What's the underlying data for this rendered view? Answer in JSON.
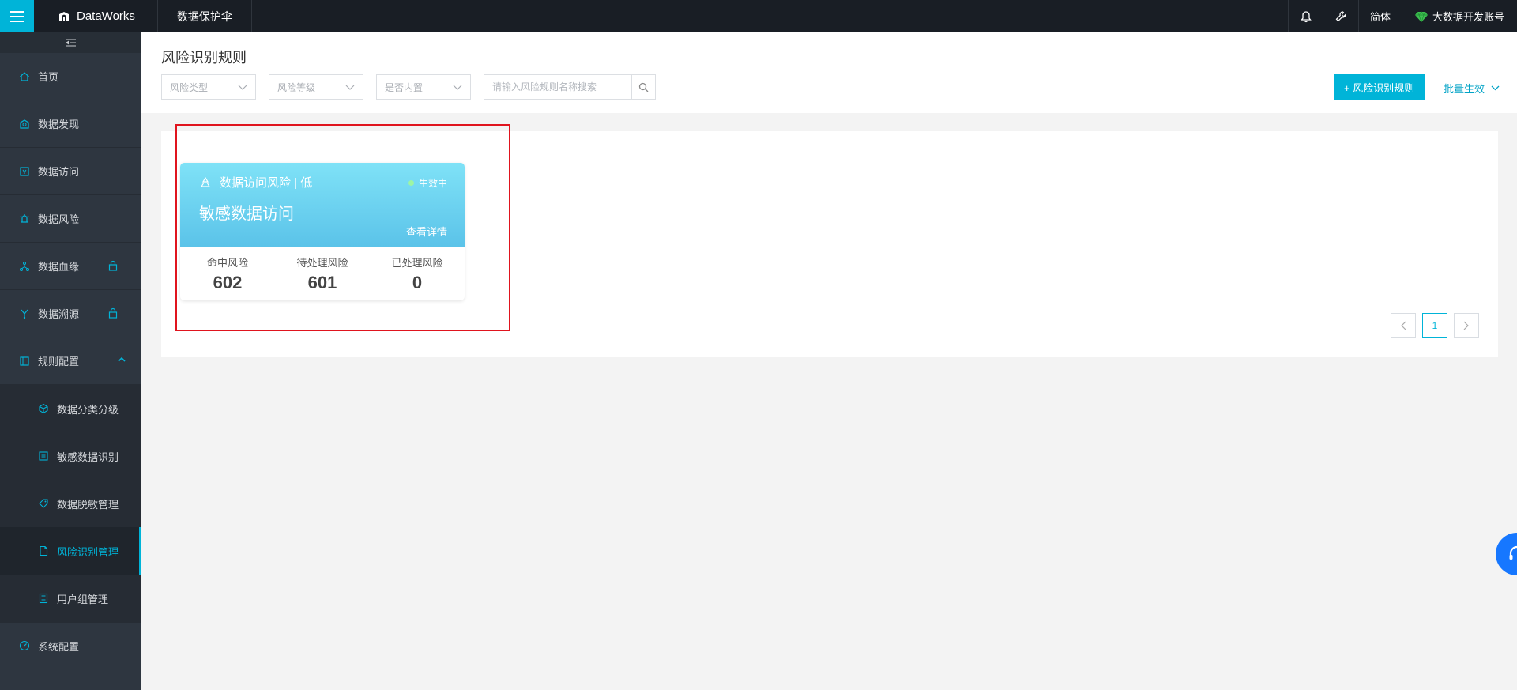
{
  "topbar": {
    "brand": "DataWorks",
    "product": "数据保护伞",
    "language": "简体",
    "account": "大数据开发账号"
  },
  "sidebar": {
    "items": [
      {
        "label": "首页",
        "icon": "home-icon"
      },
      {
        "label": "数据发现",
        "icon": "discovery-icon"
      },
      {
        "label": "数据访问",
        "icon": "access-icon"
      },
      {
        "label": "数据风险",
        "icon": "alarm-icon"
      },
      {
        "label": "数据血缘",
        "icon": "lineage-icon",
        "locked": true
      },
      {
        "label": "数据溯源",
        "icon": "trace-icon",
        "locked": true
      },
      {
        "label": "规则配置",
        "icon": "rules-icon",
        "expanded": true
      }
    ],
    "sub_items": [
      {
        "label": "数据分类分级",
        "icon": "cube-icon"
      },
      {
        "label": "敏感数据识别",
        "icon": "list-icon"
      },
      {
        "label": "数据脱敏管理",
        "icon": "tag-icon"
      },
      {
        "label": "风险识别管理",
        "icon": "doc-icon",
        "active": true
      },
      {
        "label": "用户组管理",
        "icon": "book-icon"
      }
    ],
    "bottom_item": {
      "label": "系统配置",
      "icon": "gauge-icon"
    }
  },
  "header": {
    "title": "风险识别规则",
    "filters": {
      "risk_type": "风险类型",
      "risk_level": "风险等级",
      "builtin": "是否内置"
    },
    "search_placeholder": "请输入风险规则名称搜索",
    "add_button": "+ 风险识别规则",
    "batch": "批量生效"
  },
  "card": {
    "type": "数据访问风险 | 低",
    "status": "生效中",
    "name": "敏感数据访问",
    "detail_link": "查看详情",
    "stats": [
      {
        "label": "命中风险",
        "value": "602"
      },
      {
        "label": "待处理风险",
        "value": "601"
      },
      {
        "label": "已处理风险",
        "value": "0"
      }
    ]
  },
  "pagination": {
    "current": "1"
  },
  "colors": {
    "accent": "#00b4d8",
    "topbar": "#191e25",
    "sidebar": "#2e3640",
    "card_gradient_top": "#7fe2f7",
    "card_gradient_bottom": "#5bc3e9",
    "highlight": "#e0141e"
  }
}
